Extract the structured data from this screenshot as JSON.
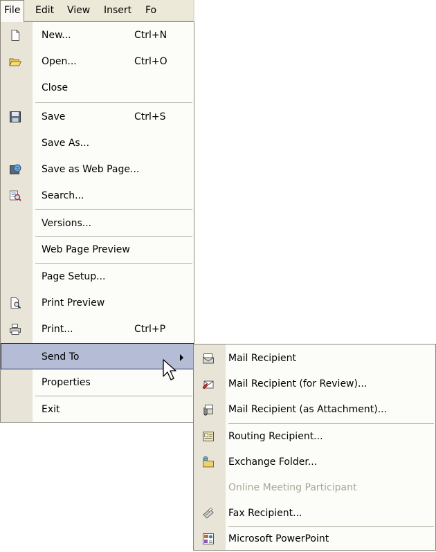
{
  "menubar": {
    "items": [
      {
        "label": "File"
      },
      {
        "label": "Edit"
      },
      {
        "label": "View"
      },
      {
        "label": "Insert"
      },
      {
        "label": "Fo"
      }
    ]
  },
  "file_menu": {
    "items": [
      {
        "label": "New...",
        "shortcut": "Ctrl+N",
        "icon": "new-document-icon"
      },
      {
        "label": "Open...",
        "shortcut": "Ctrl+O",
        "icon": "open-folder-icon"
      },
      {
        "label": "Close",
        "shortcut": "",
        "icon": ""
      },
      {
        "label": "Save",
        "shortcut": "Ctrl+S",
        "icon": "save-disk-icon"
      },
      {
        "label": "Save As...",
        "shortcut": "",
        "icon": ""
      },
      {
        "label": "Save as Web Page...",
        "shortcut": "",
        "icon": "save-web-page-icon"
      },
      {
        "label": "Search...",
        "shortcut": "",
        "icon": "search-icon"
      },
      {
        "label": "Versions...",
        "shortcut": "",
        "icon": ""
      },
      {
        "label": "Web Page Preview",
        "shortcut": "",
        "icon": ""
      },
      {
        "label": "Page Setup...",
        "shortcut": "",
        "icon": ""
      },
      {
        "label": "Print Preview",
        "shortcut": "",
        "icon": "print-preview-icon"
      },
      {
        "label": "Print...",
        "shortcut": "Ctrl+P",
        "icon": "printer-icon"
      },
      {
        "label": "Send To",
        "shortcut": "",
        "icon": "",
        "highlighted": true,
        "submenu": true
      },
      {
        "label": "Properties",
        "shortcut": "",
        "icon": ""
      },
      {
        "label": "Exit",
        "shortcut": "",
        "icon": ""
      }
    ]
  },
  "send_to_menu": {
    "items": [
      {
        "label": "Mail Recipient",
        "icon": "mail-recipient-icon"
      },
      {
        "label": "Mail Recipient (for Review)...",
        "icon": "mail-review-icon"
      },
      {
        "label": "Mail Recipient (as Attachment)...",
        "icon": "mail-attachment-icon"
      },
      {
        "label": "Routing Recipient...",
        "icon": "routing-recipient-icon"
      },
      {
        "label": "Exchange Folder...",
        "icon": "exchange-folder-icon"
      },
      {
        "label": "Online Meeting Participant",
        "icon": "",
        "disabled": true
      },
      {
        "label": "Fax Recipient...",
        "icon": "fax-icon"
      },
      {
        "label": "Microsoft PowerPoint",
        "icon": "powerpoint-icon"
      }
    ]
  },
  "colors": {
    "menubar_bg": "#ece9d8",
    "menu_bg": "#fcfcf9",
    "gutter_bg": "#e8e5d8",
    "highlight_bg": "#b4bcd6",
    "highlight_border": "#1c2e66",
    "disabled_text": "#a9a697"
  }
}
